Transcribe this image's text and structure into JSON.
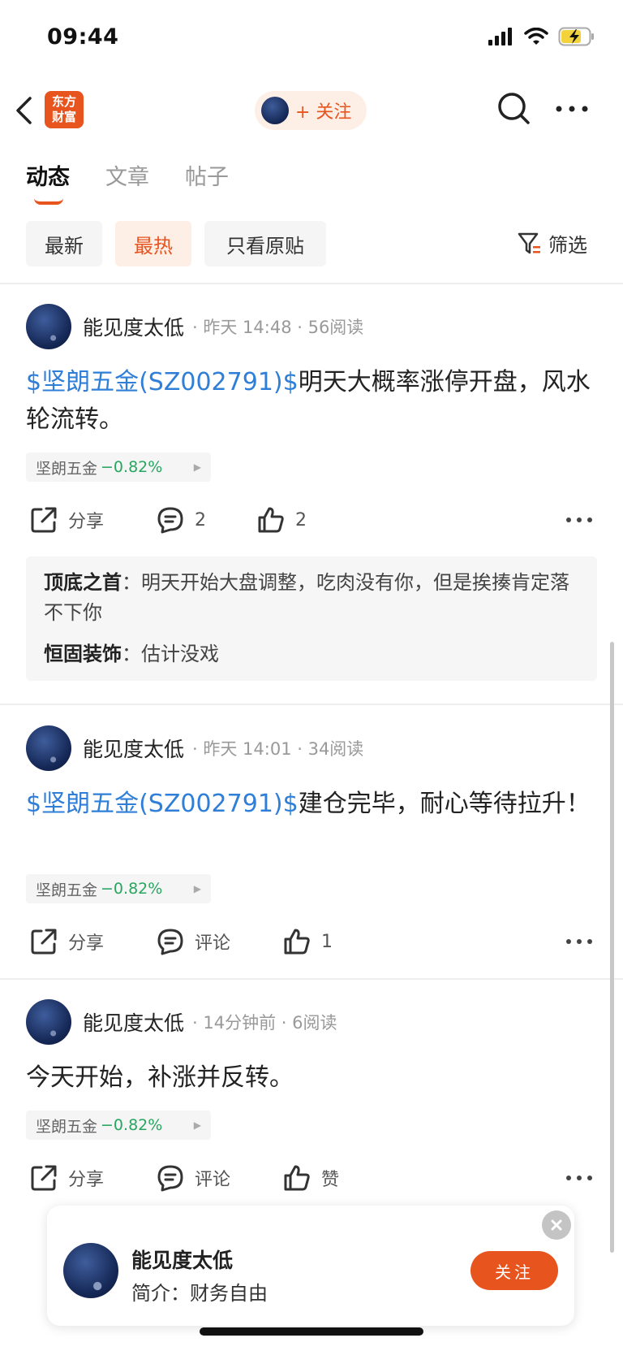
{
  "status_bar": {
    "time": "09:44"
  },
  "nav": {
    "logo_line1": "东方",
    "logo_line2": "财富",
    "follow_label": "+ 关注"
  },
  "tabs": [
    {
      "label": "动态",
      "active": true
    },
    {
      "label": "文章",
      "active": false
    },
    {
      "label": "帖子",
      "active": false
    }
  ],
  "filters": {
    "chips": [
      {
        "label": "最新",
        "active": false
      },
      {
        "label": "最热",
        "active": true
      },
      {
        "label": "只看原贴",
        "active": false
      }
    ],
    "filter_label": "筛选"
  },
  "posts": [
    {
      "author": "能见度太低",
      "meta": "· 昨天 14:48 · 56阅读",
      "tag": "$坚朗五金(SZ002791)$",
      "text": "明天大概率涨停开盘，风水轮流转。",
      "stock_name": "坚朗五金",
      "stock_change": "−0.82%",
      "share_label": "分享",
      "comment_label": "2",
      "like_label": "2",
      "comments": [
        {
          "author": "顶底之首",
          "separator": "：",
          "text": "明天开始大盘调整，吃肉没有你，但是挨揍肯定落不下你"
        },
        {
          "author": "恒固装饰",
          "separator": "：",
          "text": "估计没戏"
        }
      ]
    },
    {
      "author": "能见度太低",
      "meta": "· 昨天 14:01 · 34阅读",
      "tag": "$坚朗五金(SZ002791)$",
      "text": "建仓完毕，耐心等待拉升！",
      "stock_name": "坚朗五金",
      "stock_change": "−0.82%",
      "share_label": "分享",
      "comment_label": "评论",
      "like_label": "1"
    },
    {
      "author": "能见度太低",
      "meta": "· 14分钟前 · 6阅读",
      "tag": "",
      "text": "今天开始，补涨并反转。",
      "stock_name": "坚朗五金",
      "stock_change": "−0.82%",
      "share_label": "分享",
      "comment_label": "评论",
      "like_label": "赞"
    }
  ],
  "profile_card": {
    "name": "能见度太低",
    "bio": "简介：财务自由",
    "follow_label": "关注"
  },
  "colors": {
    "accent": "#e8541e",
    "link": "#2f7fd9",
    "stock_down": "#27a660"
  }
}
